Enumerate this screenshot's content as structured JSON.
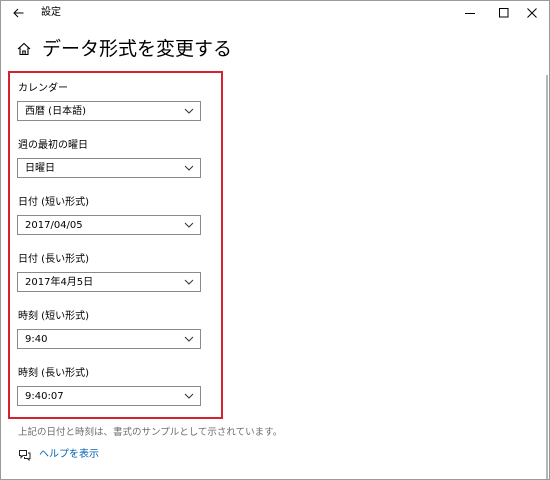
{
  "window": {
    "title": "設定"
  },
  "page": {
    "title": "データ形式を変更する"
  },
  "fields": [
    {
      "label": "カレンダー",
      "value": "西暦 (日本語)"
    },
    {
      "label": "週の最初の曜日",
      "value": "日曜日"
    },
    {
      "label": "日付 (短い形式)",
      "value": "2017/04/05"
    },
    {
      "label": "日付 (長い形式)",
      "value": "2017年4月5日"
    },
    {
      "label": "時刻 (短い形式)",
      "value": "9:40"
    },
    {
      "label": "時刻 (長い形式)",
      "value": "9:40:07"
    }
  ],
  "footer": {
    "note": "上記の日付と時刻は、書式のサンプルとして示されています。",
    "help_link": "ヘルプを表示"
  },
  "colors": {
    "highlight": "#d6212f",
    "link": "#0063b1",
    "note": "#6d6d6d",
    "window_border": "#9a9a9a"
  },
  "icons": {
    "back": "back-arrow-icon",
    "home": "home-icon",
    "minimize": "minimize-icon",
    "maximize": "maximize-icon",
    "close": "close-icon",
    "chevron": "chevron-down-icon",
    "help": "help-icon"
  }
}
